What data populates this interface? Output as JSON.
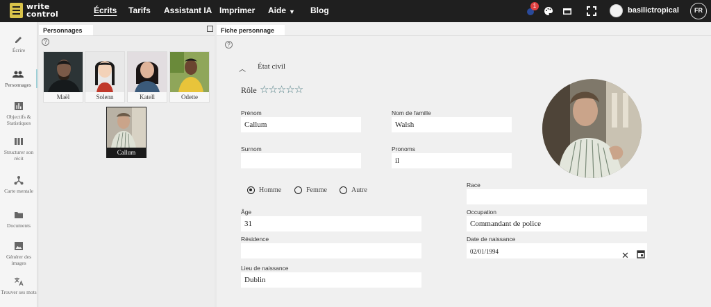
{
  "app": {
    "logo_line1": "write",
    "logo_line2": "control",
    "colors": {
      "brand": "#d9c34a",
      "topbar": "#1f1f1f",
      "accent": "#4a7a80",
      "badge": "#e04040"
    }
  },
  "nav": [
    {
      "label": "Écrits"
    },
    {
      "label": "Tarifs"
    },
    {
      "label": "Assistant IA"
    },
    {
      "label": "Imprimer"
    },
    {
      "label": "Aide"
    },
    {
      "label": "Blog"
    }
  ],
  "topbar": {
    "notification_count": "1",
    "icons": [
      "notification-icon",
      "palette-icon",
      "layout-icon",
      "fullscreen-icon"
    ],
    "username": "basilictropical",
    "language": "FR"
  },
  "sidebar": [
    {
      "label": "Écrire",
      "icon": "pencil-icon"
    },
    {
      "label": "Personnages",
      "icon": "people-icon"
    },
    {
      "label": "Objectifs & Statistiques",
      "icon": "stats-icon"
    },
    {
      "label": "Structurer son récit",
      "icon": "columns-icon"
    },
    {
      "label": "Carte mentale",
      "icon": "mindmap-icon"
    },
    {
      "label": "Documents",
      "icon": "folder-icon"
    },
    {
      "label": "Générer des images",
      "icon": "image-icon"
    },
    {
      "label": "Trouver ses mots",
      "icon": "translate-icon"
    }
  ],
  "characters_panel": {
    "tab": "Personnages",
    "help": "?",
    "characters": [
      {
        "name": "Maël"
      },
      {
        "name": "Solenn"
      },
      {
        "name": "Katell"
      },
      {
        "name": "Odette"
      },
      {
        "name": "Callum"
      }
    ]
  },
  "sheet": {
    "tab": "Fiche personnage",
    "help": "?",
    "section": "État civil",
    "role_label": "Rôle",
    "role_stars": "☆☆☆☆☆",
    "role_rating": 0,
    "fields": {
      "first_name": {
        "label": "Prénom",
        "value": "Callum"
      },
      "last_name": {
        "label": "Nom de famille",
        "value": "Walsh"
      },
      "nickname": {
        "label": "Surnom",
        "value": ""
      },
      "pronouns": {
        "label": "Pronoms",
        "value": "il"
      },
      "race": {
        "label": "Race",
        "value": ""
      },
      "age": {
        "label": "Âge",
        "value": "31"
      },
      "occupation": {
        "label": "Occupation",
        "value": "Commandant de police"
      },
      "residence": {
        "label": "Résidence",
        "value": ""
      },
      "birth_date": {
        "label": "Date de naissance",
        "value": "02/01/1994"
      },
      "birth_place": {
        "label": "Lieu de naissance",
        "value": "Dublin"
      }
    },
    "gender_options": [
      {
        "label": "Homme",
        "selected": true
      },
      {
        "label": "Femme",
        "selected": false
      },
      {
        "label": "Autre",
        "selected": false
      }
    ]
  }
}
